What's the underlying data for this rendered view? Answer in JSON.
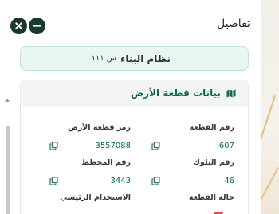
{
  "panel": {
    "title": "تفاصيل",
    "close_icon": "close-icon",
    "minimize_icon": "minus-icon"
  },
  "building_system": {
    "label": "نظام البناء",
    "value": "س ١١١"
  },
  "land_data": {
    "title": "بيانات قطعة الأرض",
    "icon": "map-icon",
    "fields": [
      {
        "label": "رقم القطعة",
        "value": "607"
      },
      {
        "label": "رمز قطعة الأرض",
        "value": "3557088"
      },
      {
        "label": "رقم البلوك",
        "value": "46"
      },
      {
        "label": "رقم المخطط",
        "value": "3443"
      },
      {
        "label": "حالة القطعة",
        "value": ""
      },
      {
        "label": "الاستخدام الرئيسي",
        "value": ""
      }
    ]
  },
  "colors": {
    "accent": "#0f6b4a",
    "dark_button": "#1a3a31",
    "system_bg": "#e9f7f1"
  }
}
